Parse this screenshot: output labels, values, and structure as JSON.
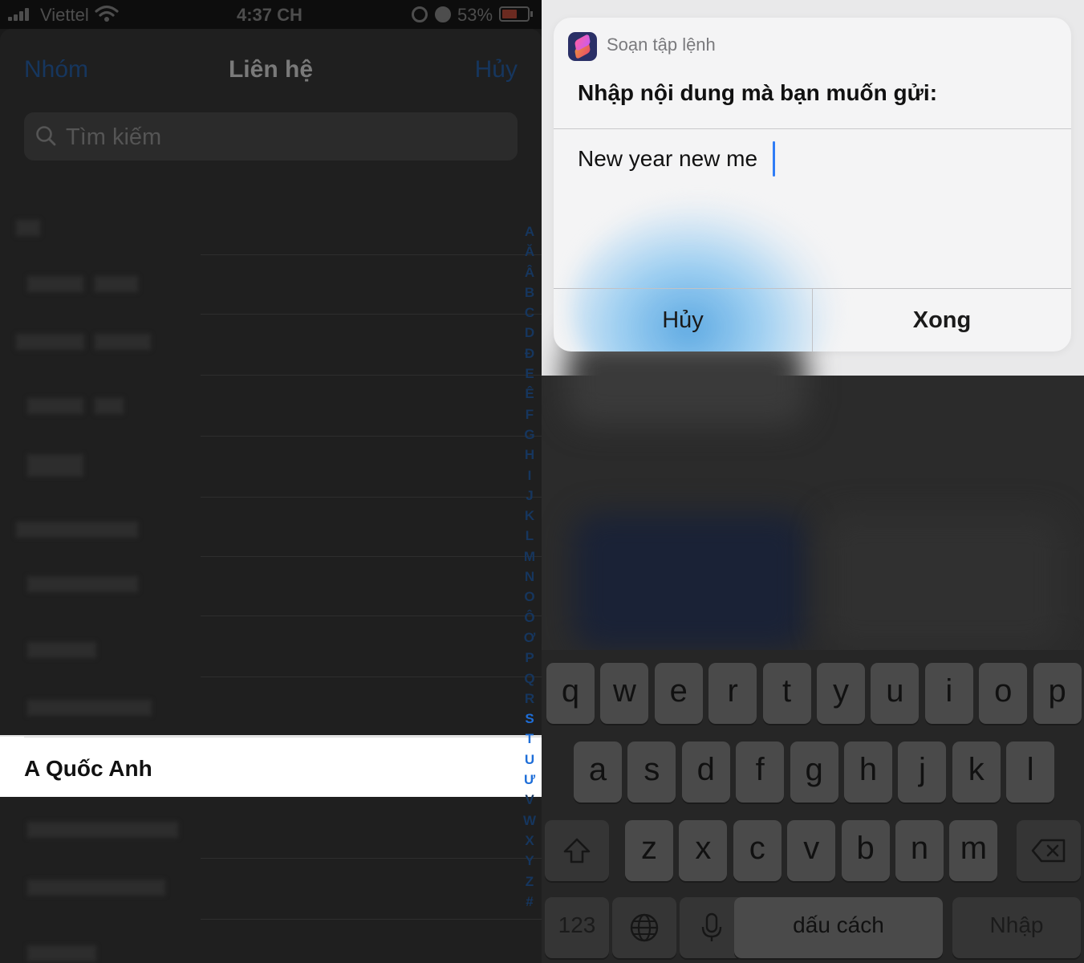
{
  "status_bar": {
    "carrier": "Viettel",
    "time": "4:37 CH",
    "battery": "53%"
  },
  "contacts": {
    "nav_left": "Nhóm",
    "title": "Liên hệ",
    "nav_right": "Hủy",
    "search_placeholder": "Tìm kiếm",
    "selected_contact": "A Quốc Anh",
    "index_letters": [
      "A",
      "Ă",
      "Â",
      "B",
      "C",
      "D",
      "Đ",
      "E",
      "Ê",
      "F",
      "G",
      "H",
      "I",
      "J",
      "K",
      "L",
      "M",
      "N",
      "O",
      "Ô",
      "Ơ",
      "P",
      "Q",
      "R",
      "S",
      "T",
      "U",
      "Ư",
      "V",
      "W",
      "X",
      "Y",
      "Z",
      "#"
    ]
  },
  "dialog": {
    "app_name": "Soạn tập lệnh",
    "prompt": "Nhập nội dung mà bạn muốn gửi:",
    "input_value": "New year new me",
    "cancel_label": "Hủy",
    "done_label": "Xong"
  },
  "keyboard": {
    "row1": [
      "q",
      "w",
      "e",
      "r",
      "t",
      "y",
      "u",
      "i",
      "o",
      "p"
    ],
    "row2": [
      "a",
      "s",
      "d",
      "f",
      "g",
      "h",
      "j",
      "k",
      "l"
    ],
    "row3": [
      "z",
      "x",
      "c",
      "v",
      "b",
      "n",
      "m"
    ],
    "numbers_label": "123",
    "space_label": "dấu cách",
    "return_label": "Nhập",
    "icons": {
      "shift": "shift-icon",
      "delete": "backspace-icon",
      "globe": "globe-icon",
      "mic": "microphone-icon"
    }
  }
}
